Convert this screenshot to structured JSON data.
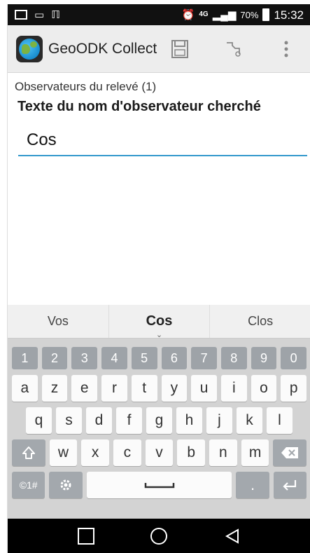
{
  "status_bar": {
    "time": "15:32",
    "battery": "70%",
    "network": "4G",
    "icons": [
      "image-notification-icon",
      "keyboard-notification-icon",
      "gallery-notification-icon",
      "alarm-icon",
      "signal-icon",
      "battery-icon"
    ]
  },
  "action_bar": {
    "title": "GeoODK Collect",
    "actions": [
      "save-icon",
      "jump-icon",
      "overflow-menu-icon"
    ]
  },
  "form": {
    "group_label": "Observateurs du relevé (1)",
    "question": "Texte du nom d'observateur cherché",
    "answer_value": "Cos"
  },
  "keyboard": {
    "suggestions": [
      "Vos",
      "Cos",
      "Clos"
    ],
    "number_row": [
      "1",
      "2",
      "3",
      "4",
      "5",
      "6",
      "7",
      "8",
      "9",
      "0"
    ],
    "row1": [
      "a",
      "z",
      "e",
      "r",
      "t",
      "y",
      "u",
      "i",
      "o",
      "p"
    ],
    "row1_alt": [
      "",
      "",
      "",
      "",
      "",
      "",
      "",
      "",
      "",
      ""
    ],
    "row2": [
      "q",
      "s",
      "d",
      "f",
      "g",
      "h",
      "j",
      "k",
      "l"
    ],
    "row3": [
      "w",
      "x",
      "c",
      "v",
      "b",
      "n",
      "m"
    ],
    "symbols_label": "©1#",
    "colors": {
      "number_key": "#9ea3a8",
      "letter_key": "#fbfbfb",
      "accent": "#3399cc"
    }
  },
  "nav_bar": {
    "buttons": [
      "recent-apps-icon",
      "home-icon",
      "back-icon"
    ]
  }
}
